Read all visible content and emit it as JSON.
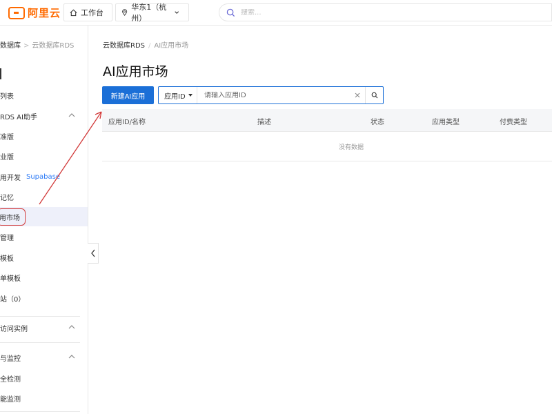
{
  "header": {
    "logo_text": "阿里云",
    "workbench_label": "工作台",
    "region_label": "华东1（杭州）",
    "search_placeholder": "搜索..."
  },
  "sidebar": {
    "breadcrumb_root": "数据库",
    "breadcrumb_sub": "云数据库RDS",
    "items": [
      {
        "label": "列表"
      },
      {
        "label": "RDS AI助手"
      },
      {
        "label": "准版"
      },
      {
        "label": "业版"
      },
      {
        "label": "用开发",
        "tag": "Supabase"
      },
      {
        "label": "记忆"
      },
      {
        "label": "用市场"
      },
      {
        "label": "管理"
      },
      {
        "label": "模板"
      },
      {
        "label": "单模板"
      },
      {
        "label": "站（0）"
      },
      {
        "label": "访问实例"
      },
      {
        "label": "与监控"
      },
      {
        "label": "全检测"
      },
      {
        "label": "能监测"
      }
    ]
  },
  "main": {
    "breadcrumb_root": "云数据库RDS",
    "breadcrumb_current": "AI应用市场",
    "title": "AI应用市场",
    "new_button_label": "新建AI应用",
    "filter_select_label": "应用ID",
    "filter_placeholder": "请输入应用ID",
    "table": {
      "columns": [
        "应用ID/名称",
        "描述",
        "状态",
        "应用类型",
        "付费类型"
      ],
      "empty_text": "没有数据"
    }
  },
  "colors": {
    "brand_orange": "#ff6a00",
    "primary_blue": "#1b6fd7",
    "annotation_red": "#d23a3a",
    "active_bg": "#eef0fa"
  }
}
